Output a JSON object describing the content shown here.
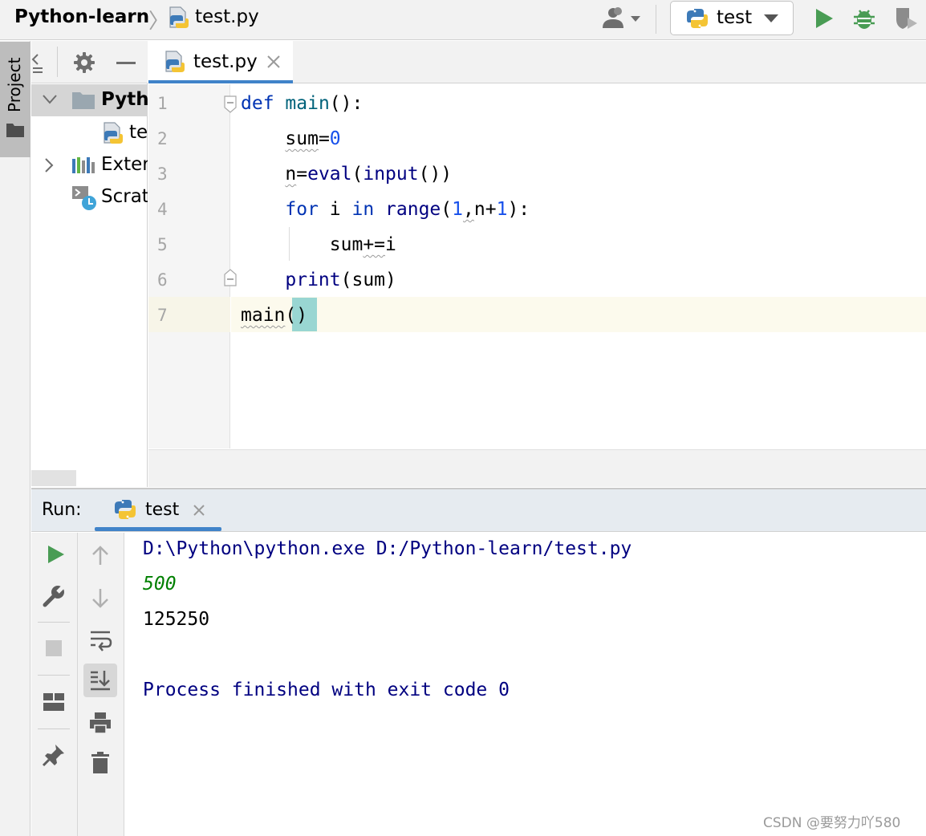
{
  "navbar": {
    "project": "Python-learn",
    "separator": "〉",
    "file": "test.py",
    "run_config": "test",
    "icons": [
      "user-icon",
      "python-file-icon",
      "python-icon",
      "run-icon",
      "debug-icon",
      "coverage-icon"
    ]
  },
  "project_window": {
    "tab_label": "Project",
    "tree": [
      {
        "label": "Python-learn",
        "expanded": true,
        "selected": true
      },
      {
        "label": "test.py"
      },
      {
        "label": "External Libraries",
        "expanded": false
      },
      {
        "label": "Scratches and Consoles"
      }
    ]
  },
  "editor": {
    "tab_label": "test.py",
    "line_numbers": [
      "1",
      "2",
      "3",
      "4",
      "5",
      "6",
      "7"
    ],
    "current_line": "7"
  },
  "run_window": {
    "title": "Run:",
    "tab_label": "test",
    "console": {
      "command": "D:\\Python\\python.exe D:/Python-learn/test.py",
      "user_input": "500",
      "output": "125250",
      "exit_message": "Process finished with exit code 0"
    }
  },
  "colors": {
    "keyword": "#0033b3",
    "function": "#00627a",
    "builtin": "#000080",
    "number": "#1750eb",
    "run_green": "#499c54",
    "accent_blue": "#4083c9",
    "input_green": "#008000",
    "caret_row": "#fcfaed",
    "paren_highlight": "#99d6d2"
  },
  "watermark": "CSDN @要努力吖580"
}
